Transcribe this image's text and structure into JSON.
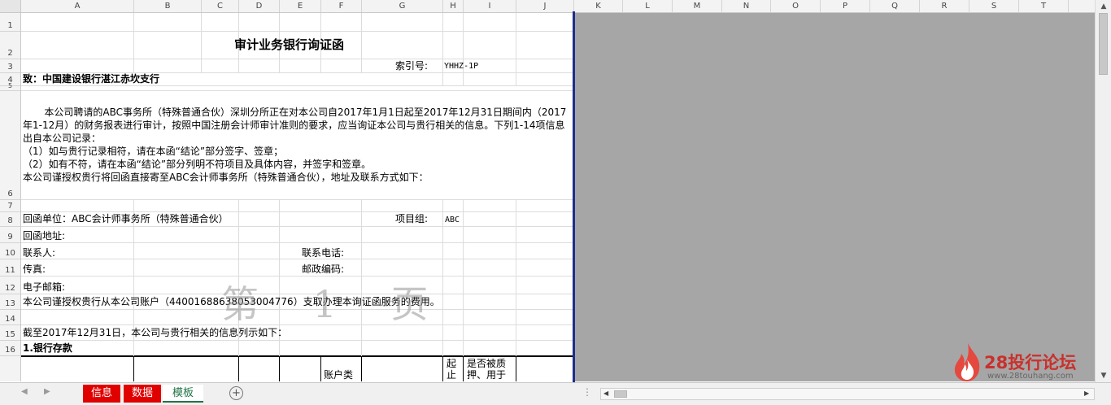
{
  "columns": [
    "A",
    "B",
    "C",
    "D",
    "E",
    "F",
    "G",
    "H",
    "I",
    "J",
    "K",
    "L",
    "M",
    "N",
    "O",
    "P",
    "Q",
    "R",
    "S",
    "T"
  ],
  "rows": [
    "1",
    "2",
    "3",
    "4",
    "5",
    "6",
    "7",
    "8",
    "9",
    "10",
    "11",
    "12",
    "13",
    "14",
    "15",
    "16"
  ],
  "sheet": {
    "title": "审计业务银行询证函",
    "index_label": "索引号:",
    "index_value": "YHHZ-1P",
    "to_line": "致：中国建设银行湛江赤坎支行",
    "para1": "本公司聘请的ABC事务所（特殊普通合伙）深圳分所正在对本公司自2017年1月1日起至2017年12月31日期间内（2017年1-12月）的财务报表进行审计，按照中国注册会计师审计准则的要求，应当询证本公司与贵行相关的信息。下列1-14项信息出自本公司记录：",
    "para2": "（1）如与贵行记录相符，请在本函“结论”部分签字、签章；",
    "para3": "（2）如有不符，请在本函“结论”部分列明不符项目及具体内容，并签字和签章。",
    "para4": "本公司谨授权贵行将回函直接寄至ABC会计师事务所（特殊普通合伙），地址及联系方式如下：",
    "reply_unit": "回函单位：ABC会计师事务所（特殊普通合伙）",
    "project_group_label": "项目组:",
    "project_group_value": "ABC",
    "reply_address": "回函地址:",
    "contact": "联系人:",
    "phone": "联系电话:",
    "fax": "传真:",
    "postcode": "邮政编码:",
    "email": "电子邮箱:",
    "authorization": "本公司谨授权贵行从本公司账户（44001688638053004776）支取办理本询证函服务的费用。",
    "as_of": "截至2017年12月31日，本公司与贵行相关的信息列示如下：",
    "section1": "1.银行存款",
    "table_hdr_account_type": "账户类",
    "table_hdr_start": "起止",
    "table_hdr_pledged": "是否被质押、用于"
  },
  "watermark": "第 1 页",
  "tabs": [
    {
      "label": "信息",
      "style": "red"
    },
    {
      "label": "数据",
      "style": "red"
    },
    {
      "label": "模板",
      "style": "active"
    }
  ],
  "add_sheet_symbol": "+",
  "logo": {
    "brand": "28投行论坛",
    "url": "www.28touhang.com",
    "accent": "#c9302c"
  },
  "colors": {
    "page_border": "#1f2d8c",
    "gray_area": "#a6a6a6",
    "tab_red": "#e00000",
    "tab_active_text": "#217346"
  }
}
